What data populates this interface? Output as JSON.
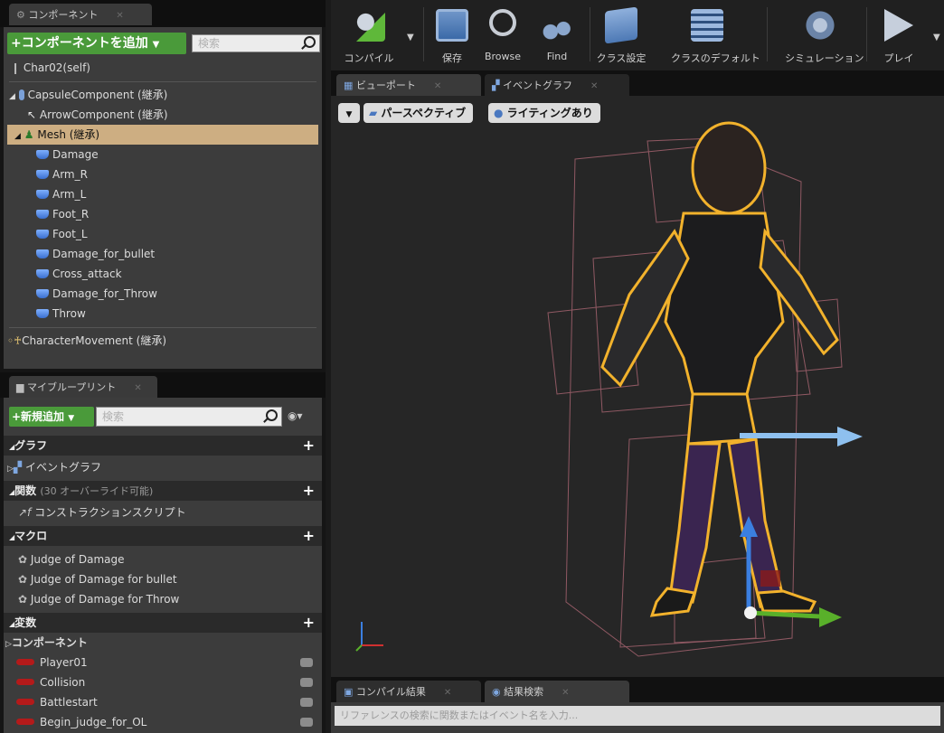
{
  "components_panel": {
    "tab_label": "コンポーネント",
    "add_button": "+コンポーネントを追加",
    "search_placeholder": "検索",
    "self_item": "Char02(self)",
    "tree": [
      {
        "label": "CapsuleComponent (継承)"
      },
      {
        "label": "ArrowComponent (継承)"
      },
      {
        "label": "Mesh (継承)"
      },
      {
        "label": "Damage"
      },
      {
        "label": "Arm_R"
      },
      {
        "label": "Arm_L"
      },
      {
        "label": "Foot_R"
      },
      {
        "label": "Foot_L"
      },
      {
        "label": "Damage_for_bullet"
      },
      {
        "label": "Cross_attack"
      },
      {
        "label": "Damage_for_Throw"
      },
      {
        "label": "Throw"
      }
    ],
    "character_movement": "CharacterMovement (継承)"
  },
  "my_blueprint": {
    "tab_label": "マイブループリント",
    "add_new": "+新規追加",
    "search_placeholder": "検索",
    "graphs_header": "グラフ",
    "event_graph": "イベントグラフ",
    "functions_header": "関数",
    "functions_note": "(30 オーバーライド可能)",
    "construction_script": "コンストラクションスクリプト",
    "macros_header": "マクロ",
    "macros": [
      "Judge of Damage",
      "Judge of Damage for bullet",
      "Judge of Damage for Throw"
    ],
    "variables_header": "変数",
    "components_sub": "コンポーネント",
    "variables": [
      "Player01",
      "Collision",
      "Battlestart",
      "Begin_judge_for_OL"
    ]
  },
  "toolbar": {
    "compile": "コンパイル",
    "save": "保存",
    "browse": "Browse",
    "find": "Find",
    "class_settings": "クラス設定",
    "class_defaults": "クラスのデフォルト",
    "simulation": "シミュレーション",
    "play": "プレイ"
  },
  "editor_tabs": {
    "viewport": "ビューポート",
    "event_graph": "イベントグラフ"
  },
  "viewport": {
    "perspective": "パースペクティブ",
    "lighting": "ライティングあり"
  },
  "bottom_tabs": {
    "compile_results": "コンパイル結果",
    "find_results": "結果検索"
  },
  "bottom_search_placeholder": "リファレンスの検索に関数またはイベント名を入力..."
}
